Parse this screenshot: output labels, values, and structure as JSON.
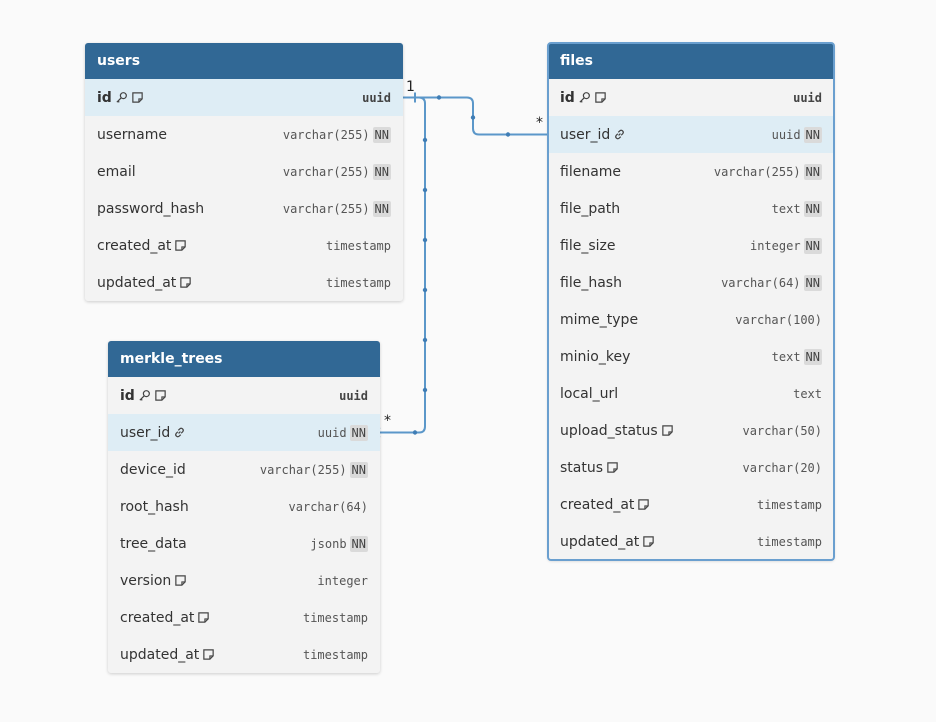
{
  "tables": [
    {
      "id": "users",
      "name": "users",
      "selected": false,
      "columns": [
        {
          "name": "id",
          "type": "uuid",
          "pk": true,
          "nn": false,
          "note": true,
          "fk": false
        },
        {
          "name": "username",
          "type": "varchar(255)",
          "pk": false,
          "nn": true,
          "note": false,
          "fk": false
        },
        {
          "name": "email",
          "type": "varchar(255)",
          "pk": false,
          "nn": true,
          "note": false,
          "fk": false
        },
        {
          "name": "password_hash",
          "type": "varchar(255)",
          "pk": false,
          "nn": true,
          "note": false,
          "fk": false
        },
        {
          "name": "created_at",
          "type": "timestamp",
          "pk": false,
          "nn": false,
          "note": true,
          "fk": false
        },
        {
          "name": "updated_at",
          "type": "timestamp",
          "pk": false,
          "nn": false,
          "note": true,
          "fk": false
        }
      ]
    },
    {
      "id": "files",
      "name": "files",
      "selected": true,
      "columns": [
        {
          "name": "id",
          "type": "uuid",
          "pk": true,
          "nn": false,
          "note": true,
          "fk": false
        },
        {
          "name": "user_id",
          "type": "uuid",
          "pk": false,
          "nn": true,
          "note": false,
          "fk": true
        },
        {
          "name": "filename",
          "type": "varchar(255)",
          "pk": false,
          "nn": true,
          "note": false,
          "fk": false
        },
        {
          "name": "file_path",
          "type": "text",
          "pk": false,
          "nn": true,
          "note": false,
          "fk": false
        },
        {
          "name": "file_size",
          "type": "integer",
          "pk": false,
          "nn": true,
          "note": false,
          "fk": false
        },
        {
          "name": "file_hash",
          "type": "varchar(64)",
          "pk": false,
          "nn": true,
          "note": false,
          "fk": false
        },
        {
          "name": "mime_type",
          "type": "varchar(100)",
          "pk": false,
          "nn": false,
          "note": false,
          "fk": false
        },
        {
          "name": "minio_key",
          "type": "text",
          "pk": false,
          "nn": true,
          "note": false,
          "fk": false
        },
        {
          "name": "local_url",
          "type": "text",
          "pk": false,
          "nn": false,
          "note": false,
          "fk": false
        },
        {
          "name": "upload_status",
          "type": "varchar(50)",
          "pk": false,
          "nn": false,
          "note": true,
          "fk": false
        },
        {
          "name": "status",
          "type": "varchar(20)",
          "pk": false,
          "nn": false,
          "note": true,
          "fk": false
        },
        {
          "name": "created_at",
          "type": "timestamp",
          "pk": false,
          "nn": false,
          "note": true,
          "fk": false
        },
        {
          "name": "updated_at",
          "type": "timestamp",
          "pk": false,
          "nn": false,
          "note": true,
          "fk": false
        }
      ]
    },
    {
      "id": "merkle_trees",
      "name": "merkle_trees",
      "selected": false,
      "columns": [
        {
          "name": "id",
          "type": "uuid",
          "pk": true,
          "nn": false,
          "note": true,
          "fk": false
        },
        {
          "name": "user_id",
          "type": "uuid",
          "pk": false,
          "nn": true,
          "note": false,
          "fk": true
        },
        {
          "name": "device_id",
          "type": "varchar(255)",
          "pk": false,
          "nn": true,
          "note": false,
          "fk": false
        },
        {
          "name": "root_hash",
          "type": "varchar(64)",
          "pk": false,
          "nn": false,
          "note": false,
          "fk": false
        },
        {
          "name": "tree_data",
          "type": "jsonb",
          "pk": false,
          "nn": true,
          "note": false,
          "fk": false
        },
        {
          "name": "version",
          "type": "integer",
          "pk": false,
          "nn": false,
          "note": true,
          "fk": false
        },
        {
          "name": "created_at",
          "type": "timestamp",
          "pk": false,
          "nn": false,
          "note": true,
          "fk": false
        },
        {
          "name": "updated_at",
          "type": "timestamp",
          "pk": false,
          "nn": false,
          "note": true,
          "fk": false
        }
      ]
    }
  ],
  "nn_label": "NN",
  "relationships": [
    {
      "from": "users.id",
      "to": "files.user_id",
      "from_card": "1",
      "to_card": "*"
    },
    {
      "from": "users.id",
      "to": "merkle_trees.user_id",
      "from_card": "",
      "to_card": "*"
    }
  ],
  "colors": {
    "header": "#316895",
    "link": "#5b97c9",
    "highlight_row": "#deedf5",
    "table_bg": "#f3f3f3",
    "nn_bg": "#dadada"
  }
}
